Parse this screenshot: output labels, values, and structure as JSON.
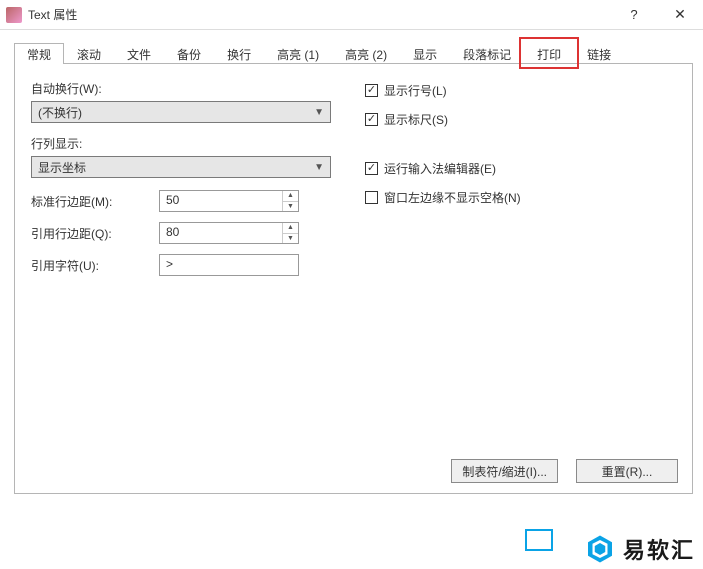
{
  "titlebar": {
    "title": "Text 属性",
    "help": "?",
    "close": "✕"
  },
  "tabs": [
    "常规",
    "滚动",
    "文件",
    "备份",
    "换行",
    "高亮 (1)",
    "高亮 (2)",
    "显示",
    "段落标记",
    "打印",
    "链接"
  ],
  "active_tab_index": 0,
  "highlight_tab_index": 9,
  "left": {
    "auto_wrap_label": "自动换行(W):",
    "auto_wrap_value": "(不换行)",
    "rowcol_label": "行列显示:",
    "rowcol_value": "显示坐标",
    "std_margin_label": "标准行边距(M):",
    "std_margin_value": "50",
    "quote_margin_label": "引用行边距(Q):",
    "quote_margin_value": "80",
    "quote_char_label": "引用字符(U):",
    "quote_char_value": ">"
  },
  "right": {
    "show_line_no": {
      "checked": true,
      "label": "显示行号(L)"
    },
    "show_ruler": {
      "checked": true,
      "label": "显示标尺(S)"
    },
    "run_ime": {
      "checked": true,
      "label": "运行输入法编辑器(E)"
    },
    "no_left_space": {
      "checked": false,
      "label": "窗口左边缘不显示空格(N)"
    }
  },
  "buttons": {
    "tabs_indent": "制表符/缩进(I)...",
    "reset": "重置(R)..."
  },
  "watermark": "易软汇"
}
